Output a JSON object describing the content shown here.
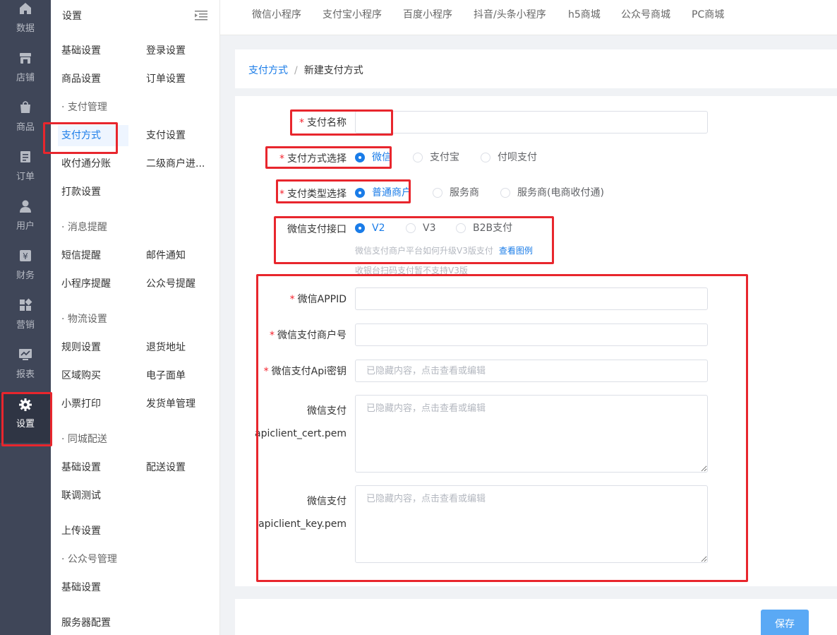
{
  "rail": {
    "items": [
      {
        "label": "数据",
        "icon": "home-icon"
      },
      {
        "label": "店铺",
        "icon": "shop-icon"
      },
      {
        "label": "商品",
        "icon": "bag-icon"
      },
      {
        "label": "订单",
        "icon": "order-icon"
      },
      {
        "label": "用户",
        "icon": "user-icon"
      },
      {
        "label": "财务",
        "icon": "finance-icon"
      },
      {
        "label": "营销",
        "icon": "marketing-icon"
      },
      {
        "label": "报表",
        "icon": "report-icon"
      },
      {
        "label": "设置",
        "icon": "gear-icon",
        "active": true
      }
    ]
  },
  "menu": {
    "title": "设置",
    "basic": "基础设置",
    "login": "登录设置",
    "goods": "商品设置",
    "order": "订单设置",
    "pay_group": "· 支付管理",
    "pay_method": "支付方式",
    "pay_setting": "支付设置",
    "split": "收付通分账",
    "sub_merchant": "二级商户进...",
    "transfer": "打款设置",
    "msg_group": "· 消息提醒",
    "sms": "短信提醒",
    "email": "邮件通知",
    "mini_notify": "小程序提醒",
    "mp_notify": "公众号提醒",
    "logistics_group": "· 物流设置",
    "rule": "规则设置",
    "return_addr": "退货地址",
    "region": "区域购买",
    "e_waybill": "电子面单",
    "receipt": "小票打印",
    "shipping": "发货单管理",
    "city_group": "· 同城配送",
    "city_basic": "基础设置",
    "delivery": "配送设置",
    "debug": "联调测试",
    "upload": "上传设置",
    "mp_group": "· 公众号管理",
    "mp_basic": "基础设置",
    "server": "服务器配置"
  },
  "tabs": [
    "微信小程序",
    "支付宝小程序",
    "百度小程序",
    "抖音/头条小程序",
    "h5商城",
    "公众号商城",
    "PC商城"
  ],
  "breadcrumb": {
    "parent": "支付方式",
    "separator": "/",
    "current": "新建支付方式"
  },
  "form": {
    "name_label": "支付名称",
    "name_value": "",
    "method_label": "支付方式选择",
    "method_options": [
      "微信",
      "支付宝",
      "付呗支付"
    ],
    "method_selected": "微信",
    "type_label": "支付类型选择",
    "type_options": [
      "普通商户",
      "服务商",
      "服务商(电商收付通)"
    ],
    "type_selected": "普通商户",
    "api_label": "微信支付接口",
    "api_options": [
      "V2",
      "V3",
      "B2B支付"
    ],
    "api_selected": "V2",
    "api_hint": "微信支付商户平台如何升级V3版支付",
    "api_hint_link": "查看图例",
    "api_hint2": "收银台扫码支付暂不支持V3版",
    "appid_label": "微信APPID",
    "appid_value": "",
    "mchid_label": "微信支付商户号",
    "mchid_value": "",
    "apikey_label": "微信支付Api密钥",
    "apikey_placeholder": "已隐藏内容，点击查看或编辑",
    "cert_label_1": "微信支付",
    "cert_label_2": "apiclient_cert.pem",
    "cert_placeholder": "已隐藏内容，点击查看或编辑",
    "key_label_1": "微信支付",
    "key_label_2": "apiclient_key.pem",
    "key_placeholder": "已隐藏内容，点击查看或编辑"
  },
  "save_label": "保存",
  "colors": {
    "accent": "#1a7ce8",
    "annotation": "#e8262d",
    "rail_bg": "#3f4658"
  }
}
